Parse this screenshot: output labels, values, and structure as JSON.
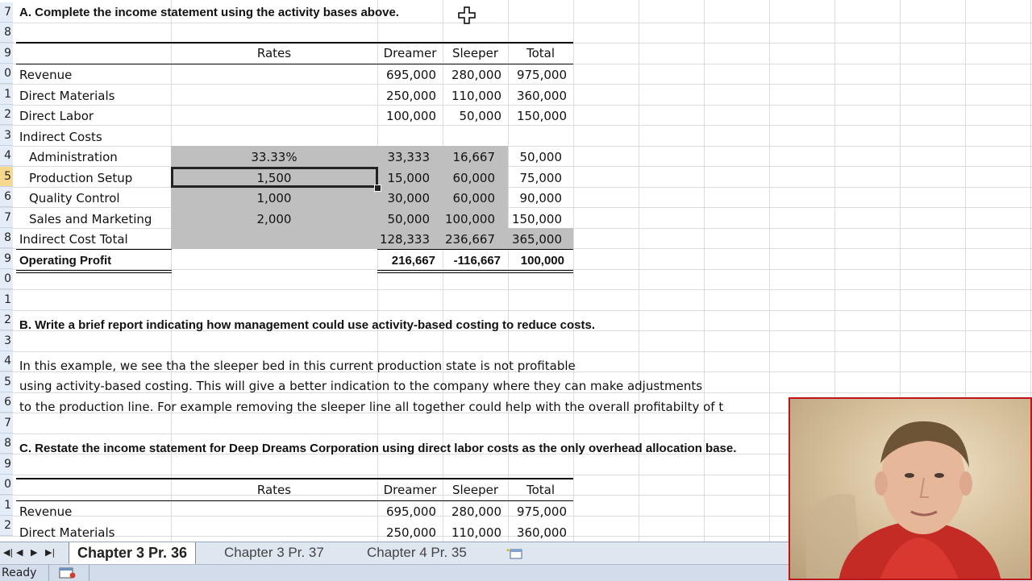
{
  "app": {
    "status": "Ready"
  },
  "row_numbers": [
    "7",
    "8",
    "9",
    "0",
    "1",
    "2",
    "3",
    "4",
    "5",
    "6",
    "7",
    "8",
    "9",
    "0",
    "1",
    "2",
    "3",
    "4",
    "5",
    "6",
    "7",
    "8",
    "9",
    "0",
    "1",
    "2"
  ],
  "section_a": {
    "title": "A. Complete the income statement using the activity bases above.",
    "headers": {
      "rates": "Rates",
      "dreamer": "Dreamer",
      "sleeper": "Sleeper",
      "total": "Total"
    },
    "rows": [
      {
        "label": "Revenue",
        "rate": "",
        "dreamer": "695,000",
        "sleeper": "280,000",
        "total": "975,000"
      },
      {
        "label": "Direct Materials",
        "rate": "",
        "dreamer": "250,000",
        "sleeper": "110,000",
        "total": "360,000"
      },
      {
        "label": "Direct Labor",
        "rate": "",
        "dreamer": "100,000",
        "sleeper": "50,000",
        "total": "150,000"
      },
      {
        "label": "Indirect Costs",
        "rate": "",
        "dreamer": "",
        "sleeper": "",
        "total": ""
      },
      {
        "label": "Administration",
        "rate": "33.33%",
        "dreamer": "33,333",
        "sleeper": "16,667",
        "total": "50,000"
      },
      {
        "label": "Production Setup",
        "rate": "1,500",
        "dreamer": "15,000",
        "sleeper": "60,000",
        "total": "75,000"
      },
      {
        "label": "Quality Control",
        "rate": "1,000",
        "dreamer": "30,000",
        "sleeper": "60,000",
        "total": "90,000"
      },
      {
        "label": "Sales and Marketing",
        "rate": "2,000",
        "dreamer": "50,000",
        "sleeper": "100,000",
        "total": "150,000"
      },
      {
        "label": "Indirect Cost Total",
        "rate": "",
        "dreamer": "128,333",
        "sleeper": "236,667",
        "total": "365,000"
      },
      {
        "label": "Operating Profit",
        "rate": "",
        "dreamer": "216,667",
        "sleeper": "-116,667",
        "total": "100,000"
      }
    ]
  },
  "section_b": {
    "title": "B. Write a brief report indicating how management could use activity-based costing to reduce costs.",
    "lines": [
      "In this example, we see tha the sleeper bed in this current production state is not profitable",
      "using activity-based costing. This will give a better indication to the company where they can make adjustments",
      "to the production line. For example removing the sleeper line all together could help with the overall profitabilty of t"
    ]
  },
  "section_c": {
    "title": "C. Restate the income statement for Deep Dreams Corporation using direct labor costs as the only overhead allocation base.",
    "headers": {
      "rates": "Rates",
      "dreamer": "Dreamer",
      "sleeper": "Sleeper",
      "total": "Total"
    },
    "rows": [
      {
        "label": "Revenue",
        "dreamer": "695,000",
        "sleeper": "280,000",
        "total": "975,000"
      },
      {
        "label": "Direct Materials",
        "dreamer": "250,000",
        "sleeper": "110,000",
        "total": "360,000"
      }
    ]
  },
  "tabs": [
    "Chapter 3 Pr. 36",
    "Chapter 3 Pr. 37",
    "Chapter 4 Pr. 35"
  ],
  "colors": {
    "selection_row": "#f8d88f",
    "shade": "#bfbfbf",
    "webcam_border": "#c0141b"
  }
}
